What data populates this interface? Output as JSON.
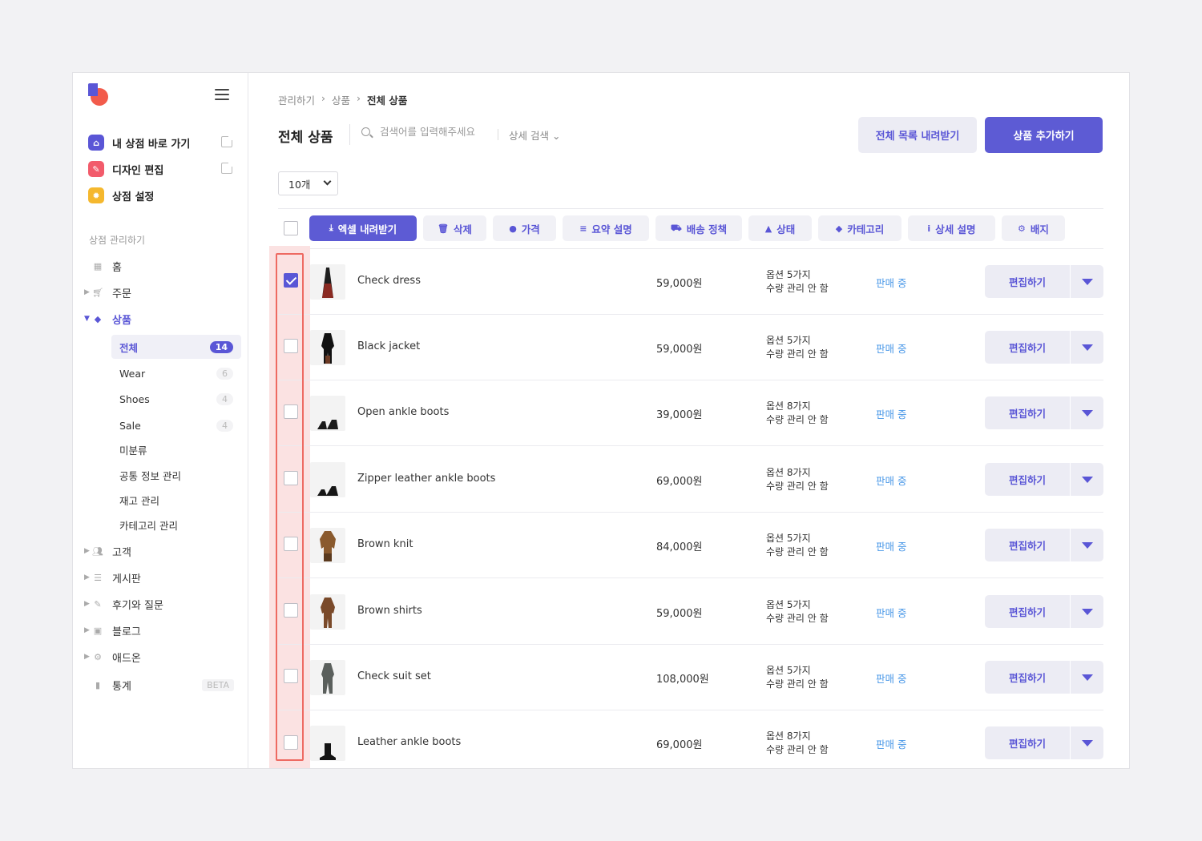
{
  "sidebar": {
    "quick_links": [
      {
        "label": "내 상점 바로 가기",
        "icon": "store-icon",
        "color": "#5a56d6"
      },
      {
        "label": "디자인 편집",
        "icon": "pencil-icon",
        "color": "#f25b6b"
      },
      {
        "label": "상점 설정",
        "icon": "gear-icon",
        "color": "#f5b82e"
      }
    ],
    "section_title": "상점 관리하기",
    "nav": [
      {
        "label": "홈",
        "icon": "grid-icon"
      },
      {
        "label": "주문",
        "icon": "cart-icon"
      },
      {
        "label": "상품",
        "icon": "box-icon"
      },
      {
        "label": "고객",
        "icon": "people-icon"
      },
      {
        "label": "게시판",
        "icon": "list-icon"
      },
      {
        "label": "후기와 질문",
        "icon": "pen-icon"
      },
      {
        "label": "블로그",
        "icon": "blog-icon"
      },
      {
        "label": "애드온",
        "icon": "addon-icon"
      },
      {
        "label": "통계",
        "icon": "chart-icon",
        "badge": "BETA"
      }
    ],
    "product_sub": [
      {
        "label": "전체",
        "count": "14"
      },
      {
        "label": "Wear",
        "count": "6"
      },
      {
        "label": "Shoes",
        "count": "4"
      },
      {
        "label": "Sale",
        "count": "4"
      },
      {
        "label": "미분류"
      },
      {
        "label": "공통 정보 관리"
      },
      {
        "label": "재고 관리"
      },
      {
        "label": "카테고리 관리"
      }
    ]
  },
  "breadcrumb": [
    "관리하기",
    "상품",
    "전체 상품"
  ],
  "header": {
    "title": "전체 상품",
    "search_placeholder": "검색어를 입력해주세요",
    "advanced_search": "상세 검색",
    "download_all": "전체 목록 내려받기",
    "add_product": "상품 추가하기"
  },
  "per_page": "10개",
  "toolbar": [
    {
      "label": "엑셀 내려받기",
      "icon": "download-icon"
    },
    {
      "label": "삭제",
      "icon": "trash-icon"
    },
    {
      "label": "가격",
      "icon": "price-icon"
    },
    {
      "label": "요약 설명",
      "icon": "summary-icon"
    },
    {
      "label": "배송 정책",
      "icon": "truck-icon"
    },
    {
      "label": "상태",
      "icon": "warning-icon"
    },
    {
      "label": "카테고리",
      "icon": "tag-icon"
    },
    {
      "label": "상세 설명",
      "icon": "info-icon"
    },
    {
      "label": "배지",
      "icon": "badge-icon"
    }
  ],
  "products": [
    {
      "name": "Check dress",
      "price": "59,000원",
      "option": "옵션 5가지",
      "stock": "수량 관리 안 함",
      "status": "판매 중",
      "checked": true
    },
    {
      "name": "Black jacket",
      "price": "59,000원",
      "option": "옵션 5가지",
      "stock": "수량 관리 안 함",
      "status": "판매 중",
      "checked": false
    },
    {
      "name": "Open ankle boots",
      "price": "39,000원",
      "option": "옵션 8가지",
      "stock": "수량 관리 안 함",
      "status": "판매 중",
      "checked": false
    },
    {
      "name": "Zipper leather ankle boots",
      "price": "69,000원",
      "option": "옵션 8가지",
      "stock": "수량 관리 안 함",
      "status": "판매 중",
      "checked": false
    },
    {
      "name": "Brown knit",
      "price": "84,000원",
      "option": "옵션 5가지",
      "stock": "수량 관리 안 함",
      "status": "판매 중",
      "checked": false
    },
    {
      "name": "Brown shirts",
      "price": "59,000원",
      "option": "옵션 5가지",
      "stock": "수량 관리 안 함",
      "status": "판매 중",
      "checked": false
    },
    {
      "name": "Check suit set",
      "price": "108,000원",
      "option": "옵션 5가지",
      "stock": "수량 관리 안 함",
      "status": "판매 중",
      "checked": false
    },
    {
      "name": "Leather ankle boots",
      "price": "69,000원",
      "option": "옵션 8가지",
      "stock": "수량 관리 안 함",
      "status": "판매 중",
      "checked": false
    }
  ],
  "edit_label": "편집하기",
  "colors": {
    "accent": "#5a56d6",
    "status": "#4a98e8",
    "highlight": "#ee6a62"
  }
}
